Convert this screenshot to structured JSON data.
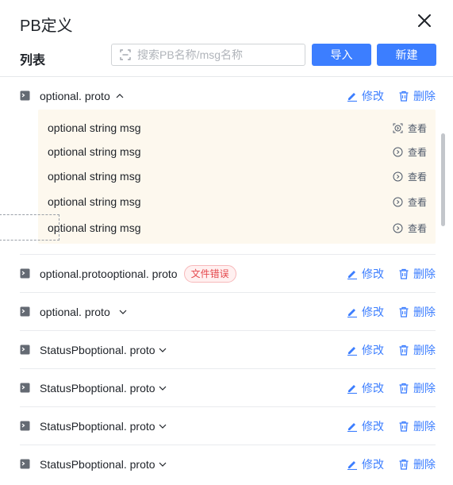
{
  "dialog": {
    "title": "PB定义",
    "list_label": "列表",
    "search_placeholder": "搜索PB名称/msg名称",
    "import_label": "导入",
    "new_label": "新建"
  },
  "actions": {
    "edit_label": "修改",
    "delete_label": "删除",
    "view_label": "查看"
  },
  "expanded_item": {
    "name": "optional. proto",
    "expanded": true,
    "messages": [
      "optional string msg",
      "optional string msg",
      "optional string msg",
      "optional string msg",
      "optional string msg"
    ]
  },
  "items": [
    {
      "name": "optional.protooptional. proto",
      "badge": "文件错误"
    },
    {
      "name": "optional. proto",
      "badge": ""
    },
    {
      "name": "StatusPboptional. proto",
      "badge": ""
    },
    {
      "name": "StatusPboptional. proto",
      "badge": ""
    },
    {
      "name": "StatusPboptional. proto",
      "badge": ""
    },
    {
      "name": "StatusPboptional. proto",
      "badge": ""
    }
  ],
  "colors": {
    "primary": "#3c7eff",
    "error": "#e5484d",
    "panel_bg": "#fdf8ee"
  }
}
